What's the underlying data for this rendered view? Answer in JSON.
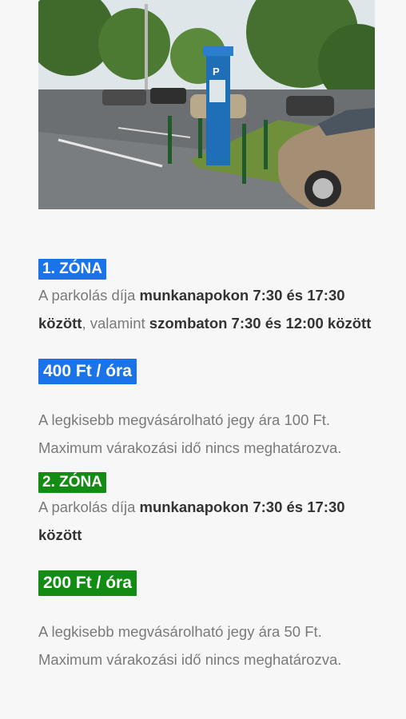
{
  "colors": {
    "zone1": "#1a73e8",
    "zone2": "#128c12",
    "bold_text": "#333333",
    "body_text": "#7a7a7a"
  },
  "photo": {
    "alt": "parking-meter-photo",
    "meter_sign": "P"
  },
  "zones": [
    {
      "badge": "1. ZÓNA",
      "desc": [
        {
          "text": "A parkolás díja ",
          "bold": false
        },
        {
          "text": "munkanapokon 7:30 és 17:30 között",
          "bold": true
        },
        {
          "text": ", valamint ",
          "bold": false
        },
        {
          "text": "szombaton 7:30 és 12:00 között",
          "bold": true
        }
      ],
      "price": "400 Ft / óra",
      "min_ticket": "A legkisebb megvásárolható jegy ára 100 Ft.",
      "max_wait": "Maximum várakozási idő nincs meghatározva."
    },
    {
      "badge": "2. ZÓNA",
      "desc": [
        {
          "text": "A parkolás díja ",
          "bold": false
        },
        {
          "text": "munkanapokon 7:30 és 17:30 között",
          "bold": true
        }
      ],
      "price": "200 Ft / óra",
      "min_ticket": "A legkisebb megvásárolható jegy ára 50 Ft.",
      "max_wait": "Maximum várakozási idő nincs meghatározva."
    }
  ]
}
